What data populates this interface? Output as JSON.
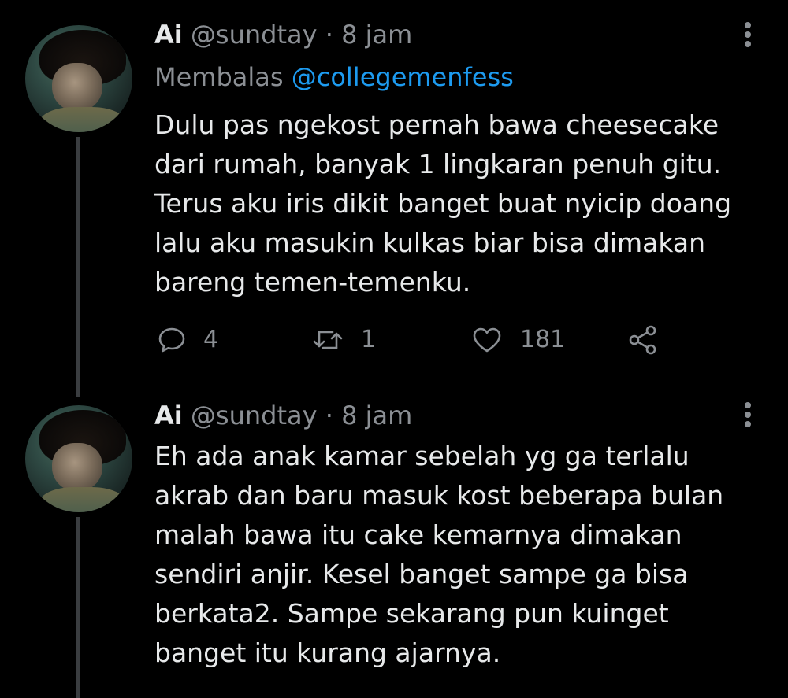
{
  "tweets": [
    {
      "author_name": "Ai",
      "handle": "@sundtay",
      "separator": "·",
      "time": "8 jam",
      "reply_label": "Membalas",
      "reply_mention": "@collegemenfess",
      "lines": [
        "Dulu pas ngekost pernah bawa cheesecake",
        "dari rumah, banyak 1 lingkaran penuh gitu.",
        "Terus aku iris dikit banget buat nyicip doang",
        "lalu aku masukin kulkas biar bisa dimakan",
        "bareng temen-temenku."
      ],
      "actions": {
        "reply_icon": "reply-icon",
        "reply_count": "4",
        "retweet_icon": "retweet-icon",
        "retweet_count": "1",
        "like_icon": "heart-icon",
        "like_count": "181",
        "share_icon": "share-icon"
      }
    },
    {
      "author_name": "Ai",
      "handle": "@sundtay",
      "separator": "·",
      "time": "8 jam",
      "lines": [
        "Eh ada anak kamar sebelah yg ga terlalu",
        "akrab dan baru masuk kost beberapa bulan",
        "malah bawa itu cake kemarnya dimakan",
        "sendiri anjir. Kesel banget sampe ga bisa",
        "berkata2. Sampe sekarang pun kuinget",
        "banget itu kurang ajarnya."
      ]
    }
  ],
  "colors": {
    "background": "#000000",
    "text_primary": "#e7e9ea",
    "text_secondary": "#8b8f94",
    "link": "#1d9bf0",
    "thread_line": "#3a3d40"
  }
}
